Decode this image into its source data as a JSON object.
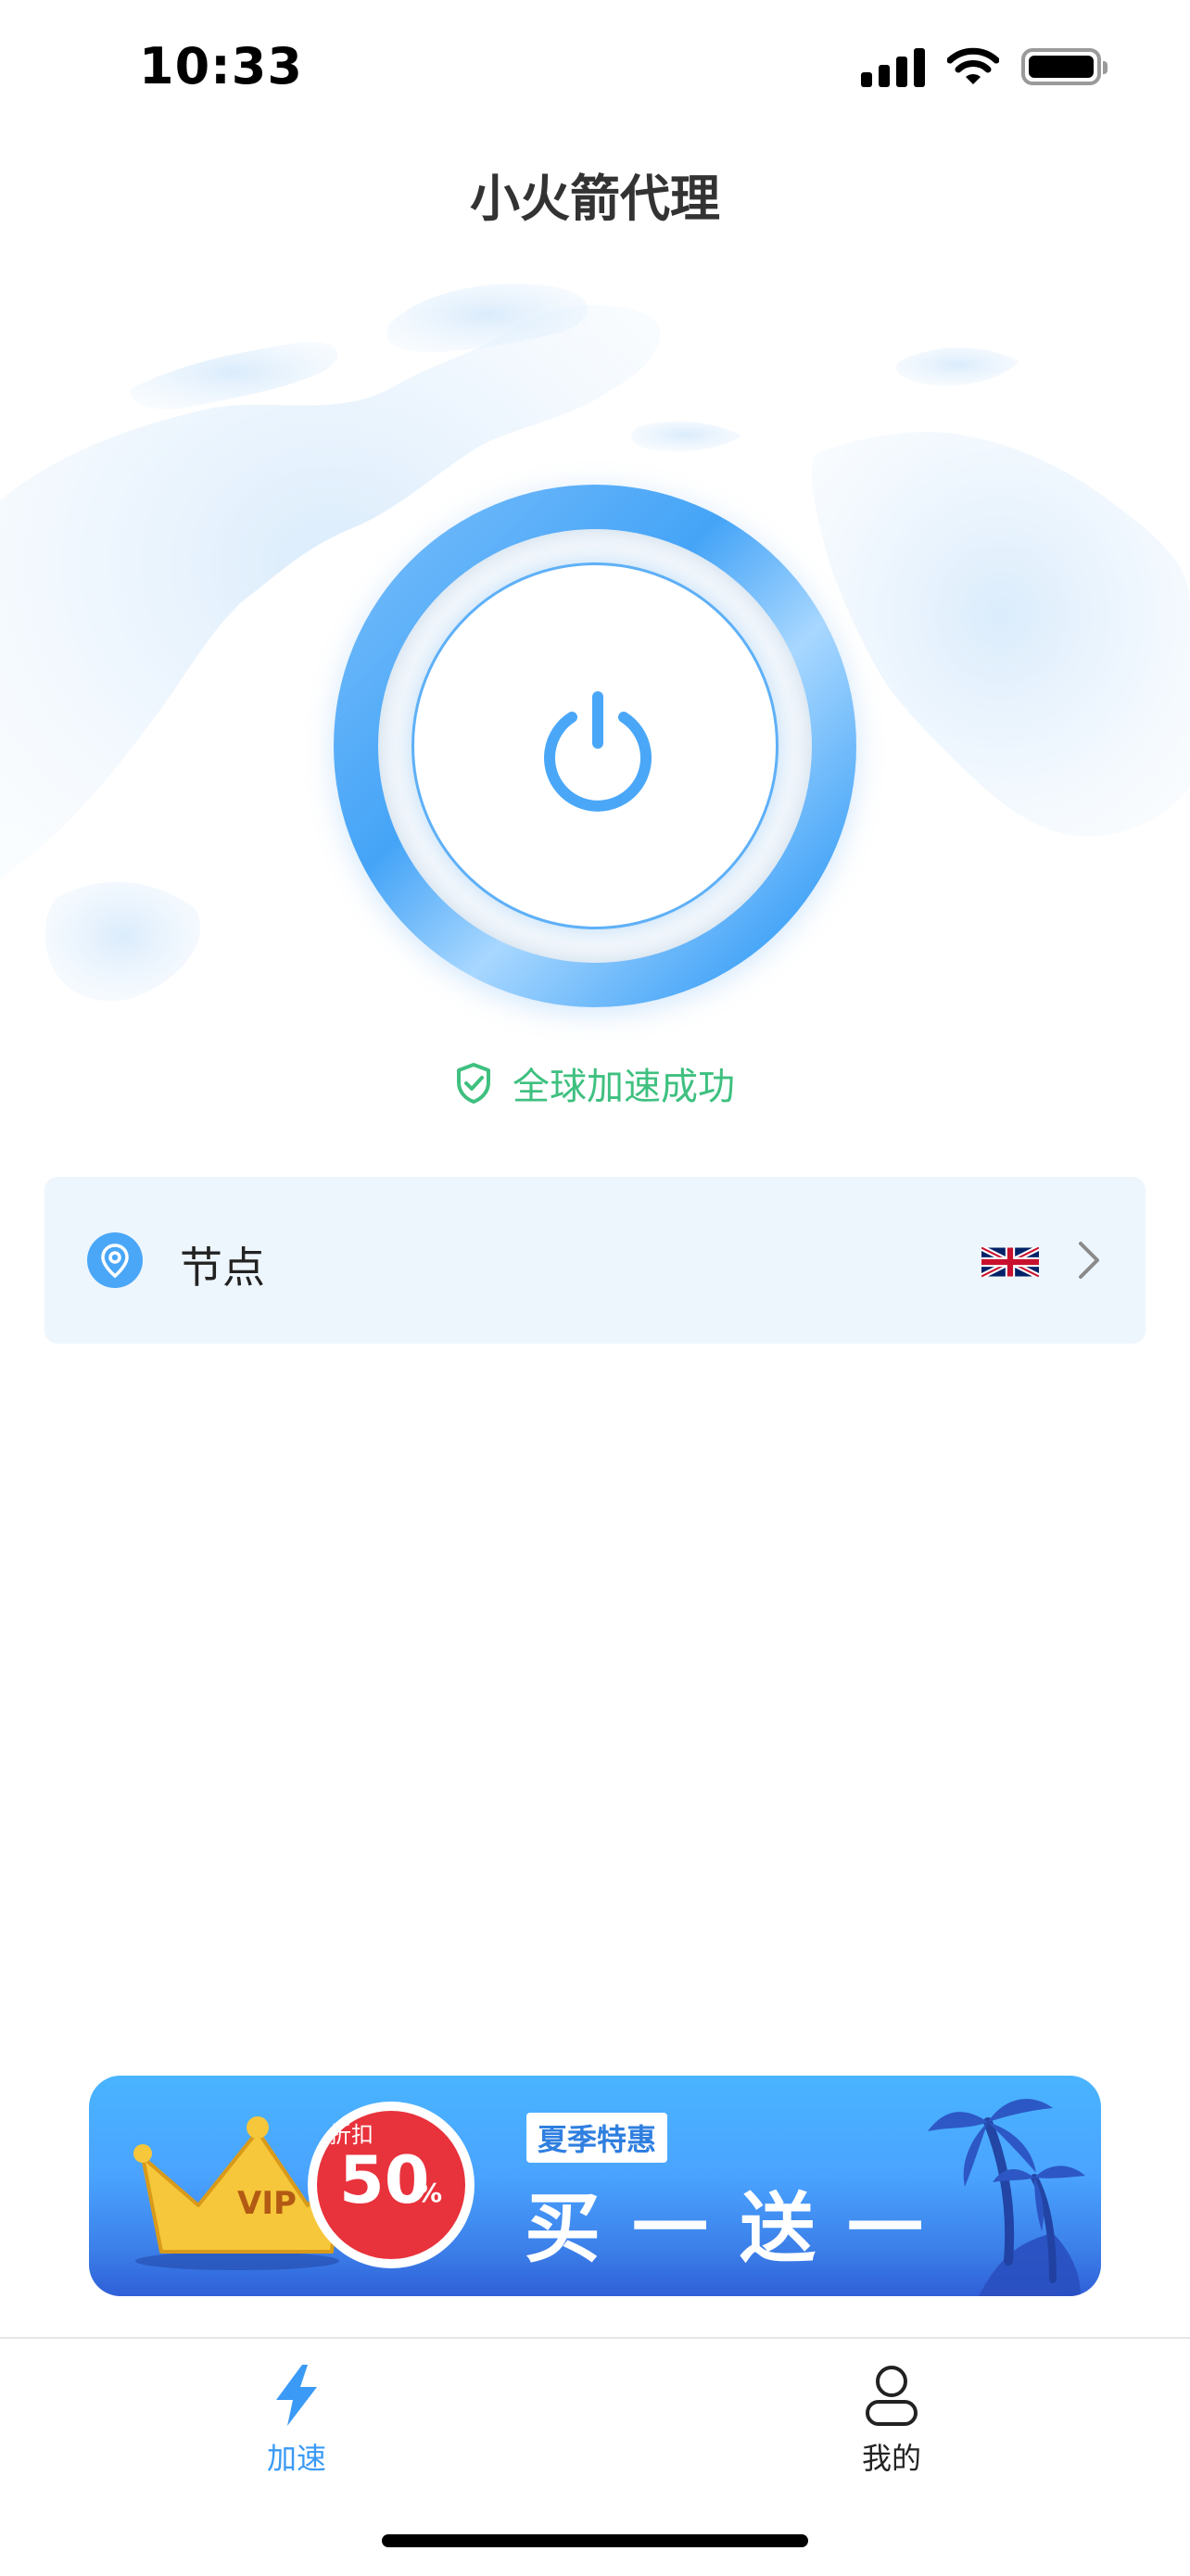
{
  "status_bar": {
    "time": "10:33",
    "icons": [
      "cellular-signal-icon",
      "wifi-icon",
      "battery-icon"
    ]
  },
  "app": {
    "title": "小火箭代理"
  },
  "connection": {
    "power_icon": "power-icon",
    "status_icon": "shield-check-icon",
    "status_text": "全球加速成功",
    "accent_color": "#4aa7f8",
    "status_color": "#3fc080"
  },
  "node": {
    "icon": "location-pin-icon",
    "label": "节点",
    "flag": "united-kingdom-flag-icon",
    "chevron": "chevron-right-icon"
  },
  "promo": {
    "badge_top": "折扣",
    "badge_value": "50",
    "badge_unit": "%",
    "tag": "夏季特惠",
    "headline": "买一送一",
    "crown_text": "VIP"
  },
  "tab_bar": {
    "tabs": [
      {
        "label": "加速",
        "icon": "lightning-bolt-icon",
        "active": true
      },
      {
        "label": "我的",
        "icon": "user-icon",
        "active": false
      }
    ]
  }
}
